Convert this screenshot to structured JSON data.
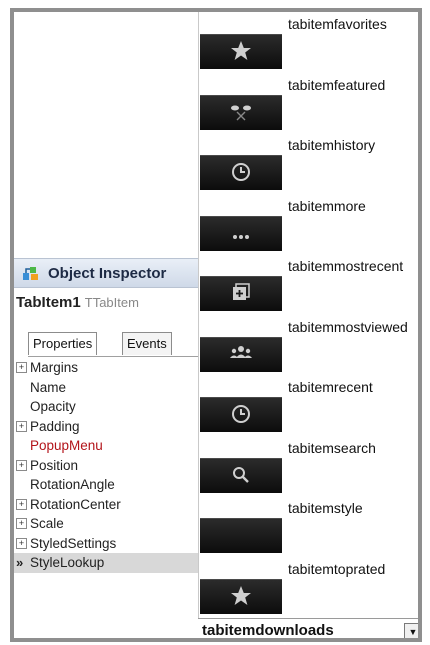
{
  "inspector": {
    "title": "Object Inspector",
    "component_name": "TabItem1",
    "component_type": "TTabItem",
    "tabs": [
      {
        "label": "Properties",
        "active": true
      },
      {
        "label": "Events",
        "active": false
      }
    ],
    "properties": [
      {
        "label": "Margins",
        "expandable": true
      },
      {
        "label": "Name",
        "expandable": false
      },
      {
        "label": "Opacity",
        "expandable": false
      },
      {
        "label": "Padding",
        "expandable": true
      },
      {
        "label": "PopupMenu",
        "expandable": false,
        "highlight": "#b3141a"
      },
      {
        "label": "Position",
        "expandable": true
      },
      {
        "label": "RotationAngle",
        "expandable": false
      },
      {
        "label": "RotationCenter",
        "expandable": true
      },
      {
        "label": "Scale",
        "expandable": true
      },
      {
        "label": "StyledSettings",
        "expandable": true
      },
      {
        "label": "StyleLookup",
        "expandable": false,
        "selected": true,
        "marker": "»"
      }
    ]
  },
  "style_list": [
    {
      "name": "tabitemfavorites",
      "icon": "star-icon"
    },
    {
      "name": "tabitemfeatured",
      "icon": "featured-icon"
    },
    {
      "name": "tabitemhistory",
      "icon": "clock-icon"
    },
    {
      "name": "tabitemmore",
      "icon": "more-dots-icon"
    },
    {
      "name": "tabitemmostrecent",
      "icon": "most-recent-icon"
    },
    {
      "name": "tabitemmostviewed",
      "icon": "people-icon"
    },
    {
      "name": "tabitemrecent",
      "icon": "clock-icon"
    },
    {
      "name": "tabitemsearch",
      "icon": "search-icon"
    },
    {
      "name": "tabitemstyle",
      "icon": ""
    },
    {
      "name": "tabitemtoprated",
      "icon": "star-icon"
    }
  ],
  "style_lookup": {
    "value": "tabitemdownloads",
    "dropdown_icon": "chevron-down-icon"
  }
}
